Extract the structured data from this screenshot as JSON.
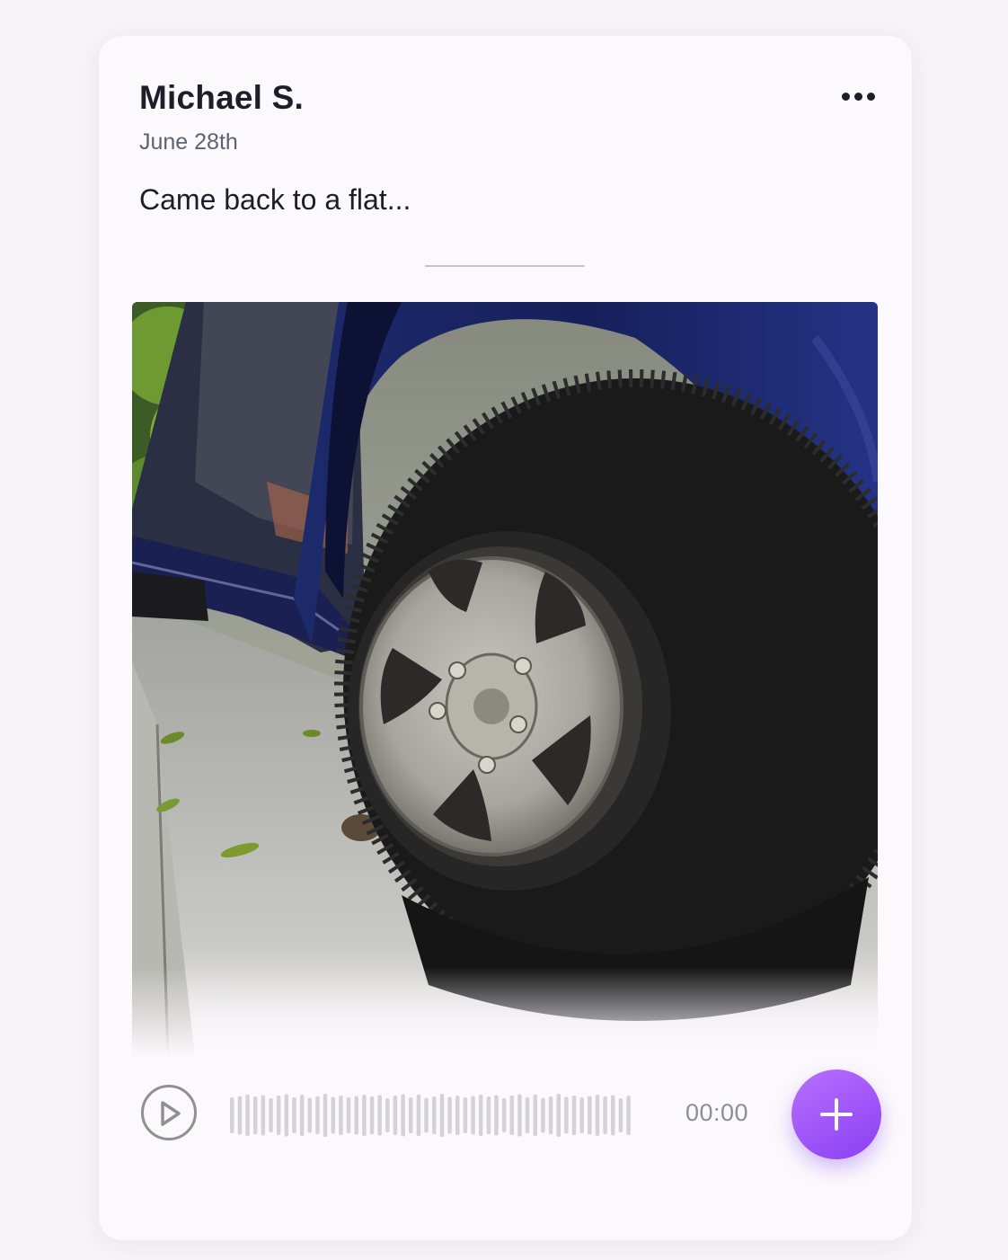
{
  "post": {
    "author": "Michael S.",
    "date": "June 28th",
    "caption": "Came back to a flat..."
  },
  "menu": {
    "icon": "more-horizontal-icon"
  },
  "media": {
    "subject": "photo"
  },
  "audio": {
    "time": "00:00",
    "progress": 0,
    "play_icon": "play-icon"
  },
  "fab": {
    "icon": "plus-icon"
  },
  "colors": {
    "accent_start": "#b870ff",
    "accent_end": "#8a3ff2",
    "text_primary": "#1c1f2a",
    "text_secondary": "#5d6370",
    "card_background": "#fbf9fc"
  }
}
